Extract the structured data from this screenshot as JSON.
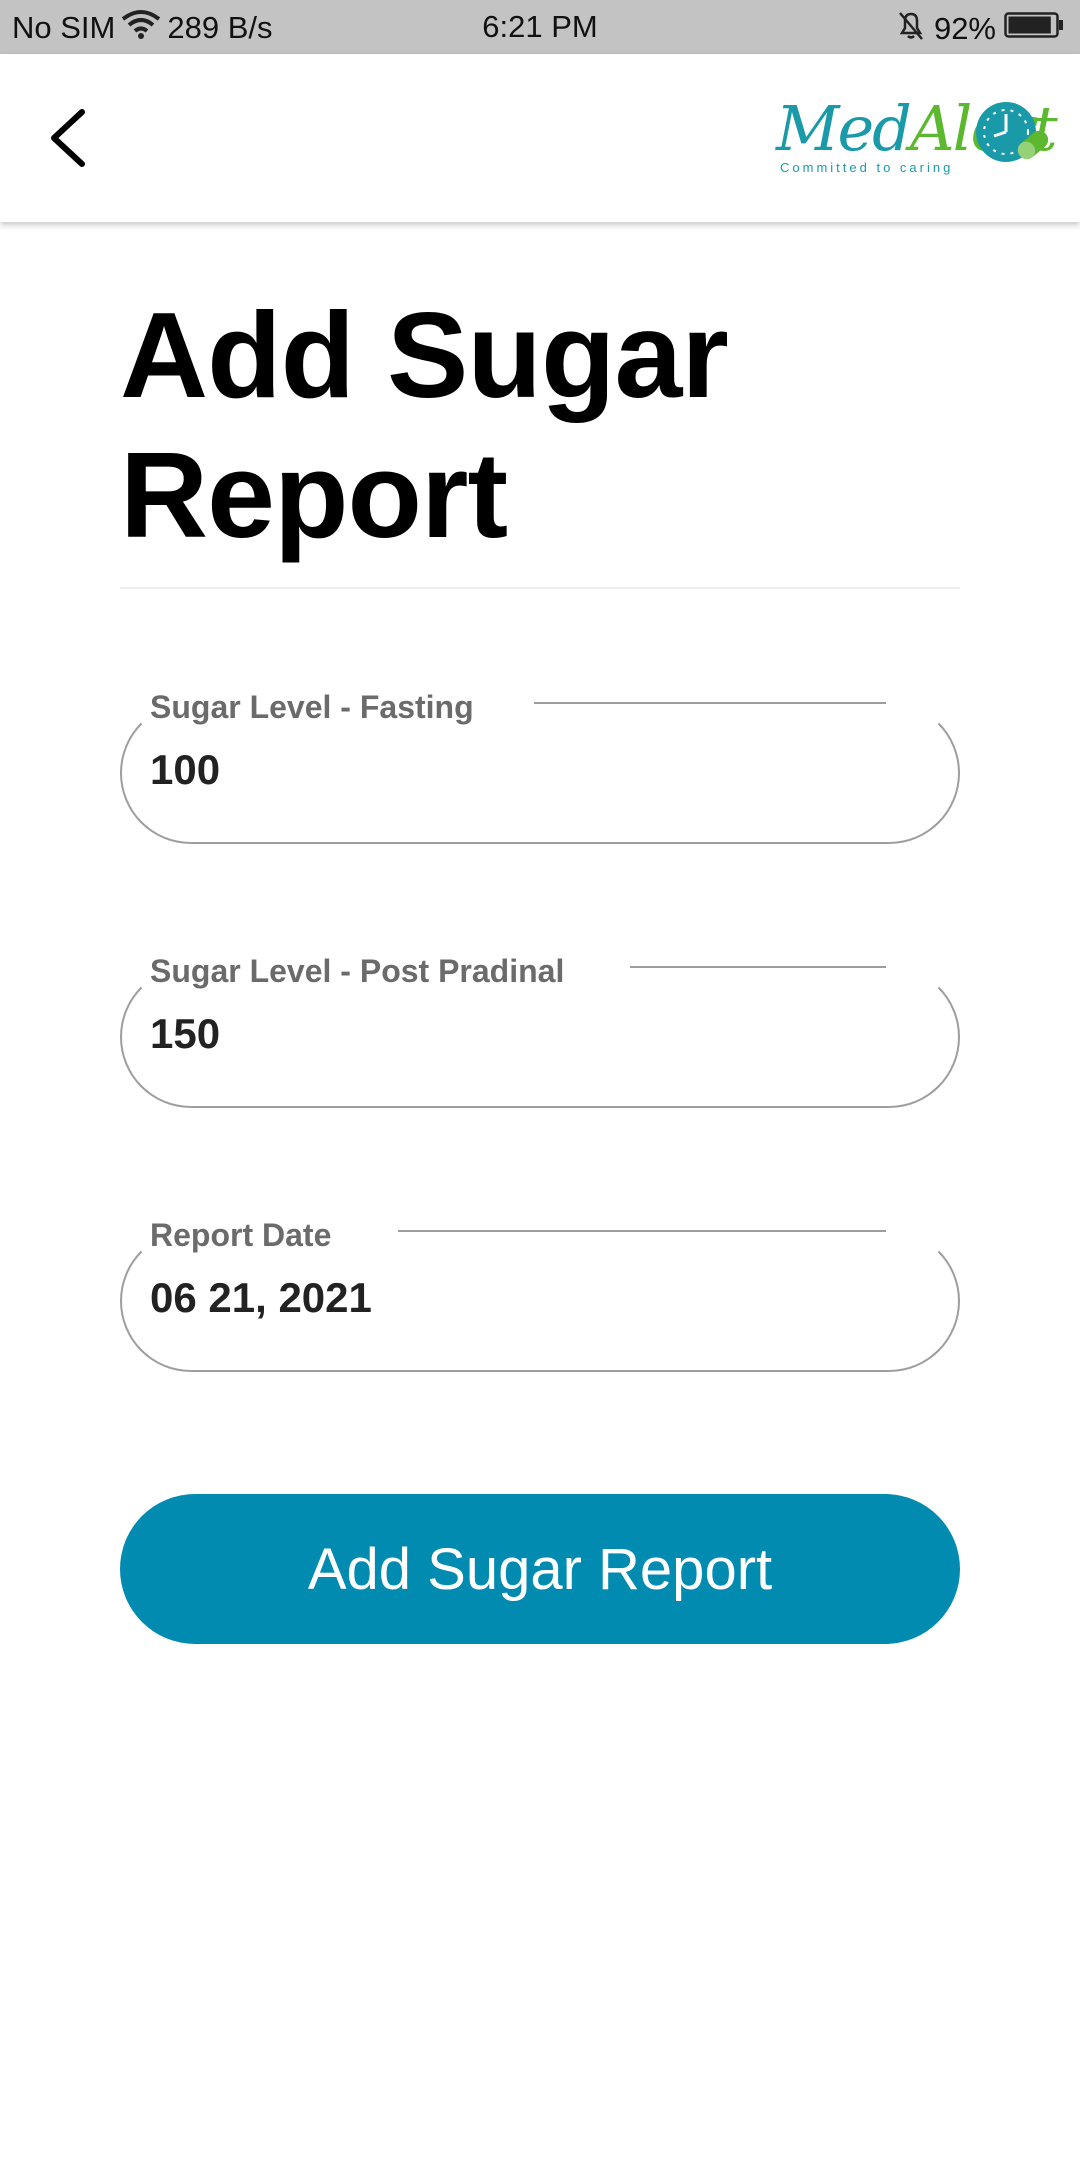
{
  "status_bar": {
    "carrier": "No SIM",
    "net_speed": "289 B/s",
    "time": "6:21 PM",
    "battery": "92%",
    "battery_level": 0.92,
    "icons": [
      "wifi-icon",
      "bell-off-icon",
      "battery-icon"
    ]
  },
  "header": {
    "back_icon": "chevron-left-icon",
    "logo_text_part1": "Med",
    "logo_text_part2": "Alert",
    "logo_tagline": "Committed to caring",
    "logo_colors": {
      "teal": "#1a9aa8",
      "green": "#5cb82e"
    }
  },
  "page": {
    "title": "Add Sugar Report"
  },
  "form": {
    "fasting": {
      "label": "Sugar Level - Fasting",
      "value": "100"
    },
    "post_prandial": {
      "label": "Sugar Level - Post Pradinal",
      "value": "150"
    },
    "report_date": {
      "label": "Report Date",
      "value": "06 21, 2021"
    },
    "submit_label": "Add Sugar Report"
  },
  "colors": {
    "accent": "#028bb1",
    "status_bar_bg": "#c3c3c3",
    "field_border": "#9e9e9e"
  }
}
